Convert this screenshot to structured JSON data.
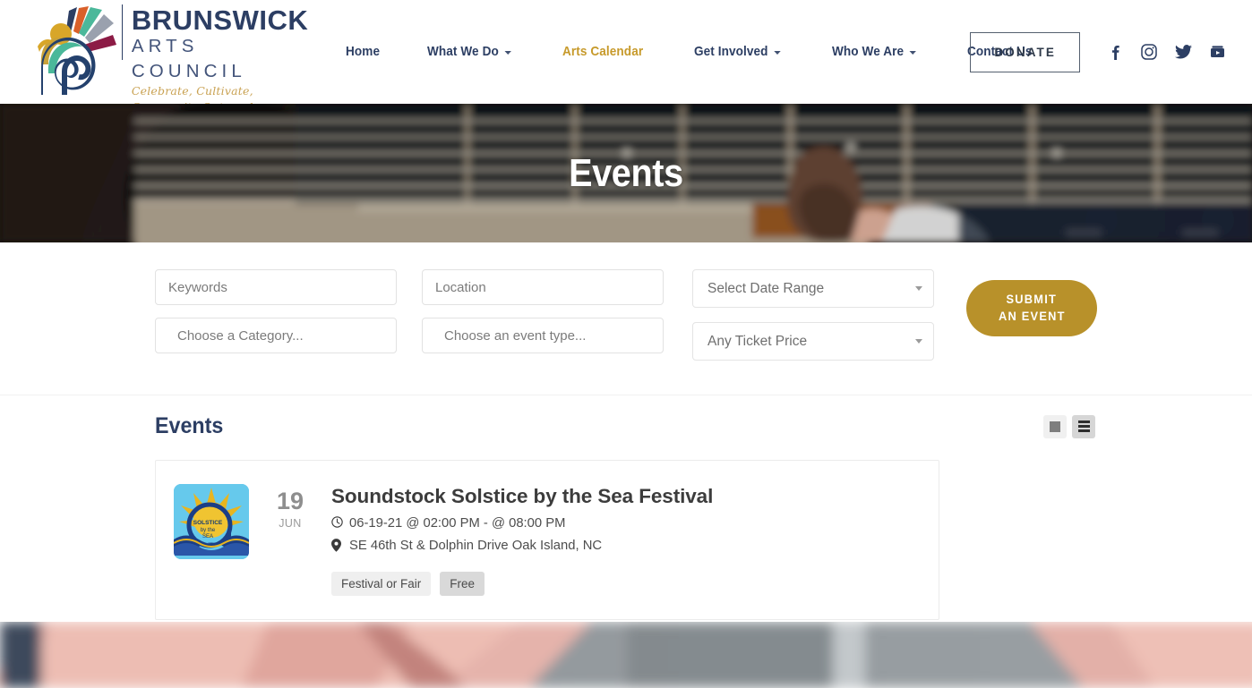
{
  "header": {
    "logo": {
      "line1": "BRUNSWICK",
      "line2": "ARTS COUNCIL",
      "tagline": "Celebrate, Cultivate, Community Outreach",
      "icon_name": "brunswick-arts-council-logo"
    },
    "nav": [
      {
        "label": "Home",
        "has_caret": false,
        "active": false
      },
      {
        "label": "What We Do",
        "has_caret": true,
        "active": false
      },
      {
        "label": "Arts Calendar",
        "has_caret": false,
        "active": true
      },
      {
        "label": "Get Involved",
        "has_caret": true,
        "active": false
      },
      {
        "label": "Who We Are",
        "has_caret": true,
        "active": false
      },
      {
        "label": "Contact Us",
        "has_caret": false,
        "active": false
      }
    ],
    "donate_label": "DONATE",
    "social": [
      {
        "name": "facebook-icon",
        "label": "Facebook"
      },
      {
        "name": "instagram-icon",
        "label": "Instagram"
      },
      {
        "name": "twitter-icon",
        "label": "Twitter"
      },
      {
        "name": "youtube-icon",
        "label": "YouTube"
      }
    ],
    "active_nav_color": "#c79a2b",
    "nav_color": "#2c3e63"
  },
  "hero": {
    "title": "Events",
    "image_alt": "Close-up of hands playing an acoustic guitar fretboard"
  },
  "filters": {
    "keywords": {
      "value": "",
      "placeholder": "Keywords"
    },
    "location": {
      "value": "",
      "placeholder": "Location"
    },
    "category": {
      "value": "",
      "placeholder": "Choose a Category..."
    },
    "event_type": {
      "value": "",
      "placeholder": "Choose an event type..."
    },
    "date_range": {
      "selected": "Select Date Range"
    },
    "ticket_price": {
      "selected": "Any Ticket Price"
    },
    "submit_line1": "SUBMIT",
    "submit_line2": "AN EVENT",
    "submit_color": "#b8912a"
  },
  "events": {
    "heading": "Events",
    "views": [
      {
        "name": "grid-view-toggle",
        "label": "Grid view",
        "active": false
      },
      {
        "name": "list-view-toggle",
        "label": "List view",
        "active": true
      }
    ],
    "items": [
      {
        "day": "19",
        "month": "JUN",
        "title": "Soundstock Solstice by the Sea Festival",
        "datetime": "06-19-21 @ 02:00 PM - @ 08:00 PM",
        "location": "SE 46th St & Dolphin Drive Oak Island, NC",
        "thumb_text_1": "SOLSTICE",
        "thumb_text_2": "by the",
        "thumb_text_3": "SEA",
        "tags": [
          {
            "label": "Festival or Fair",
            "style": "light"
          },
          {
            "label": "Free",
            "style": "dark"
          }
        ]
      }
    ]
  },
  "footer": {
    "image_alt": "Blurred close-up of pink fabric and a gray background"
  }
}
